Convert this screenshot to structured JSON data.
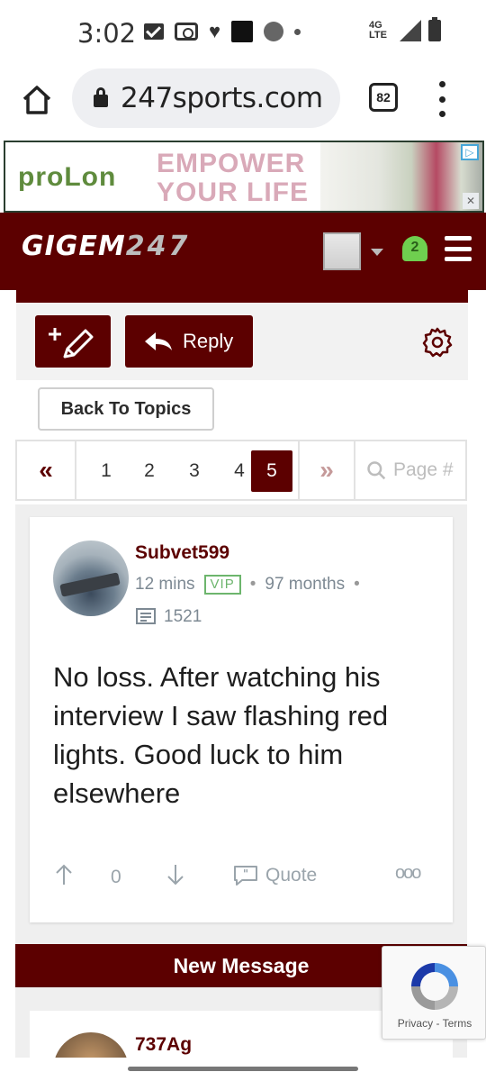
{
  "status_bar": {
    "time": "3:02",
    "network": "4G LTE"
  },
  "browser": {
    "url": "247sports.com",
    "tab_count": "82"
  },
  "ad": {
    "brand": "proLon",
    "headline_line1": "EMPOWER",
    "headline_line2": "YOUR LIFE"
  },
  "site": {
    "logo_text": "GIGEM",
    "logo_number": "247",
    "notification_count": "2"
  },
  "toolbar": {
    "reply_label": "Reply"
  },
  "back_button": "Back To Topics",
  "pagination": {
    "first_label": "«",
    "last_label": "»",
    "pages": [
      "1",
      "2",
      "3",
      "4",
      "5"
    ],
    "active_page": "5",
    "search_placeholder": "Page #"
  },
  "post": {
    "username": "Subvet599",
    "time_ago": "12 mins",
    "badge": "VIP",
    "tenure": "97 months",
    "post_count": "1521",
    "body": "No loss. After watching his interview I saw flashing red lights. Good luck to him elsewhere",
    "vote_count": "0",
    "quote_label": "Quote",
    "more_label": "ooo"
  },
  "new_message_label": "New Message",
  "next_post": {
    "username": "737Ag"
  },
  "recaptcha": {
    "privacy": "Privacy",
    "separator": "-",
    "terms": "Terms"
  },
  "colors": {
    "brand_maroon": "#5c0000",
    "vip_green": "#6db56d",
    "bell_green": "#6fcf4f"
  }
}
